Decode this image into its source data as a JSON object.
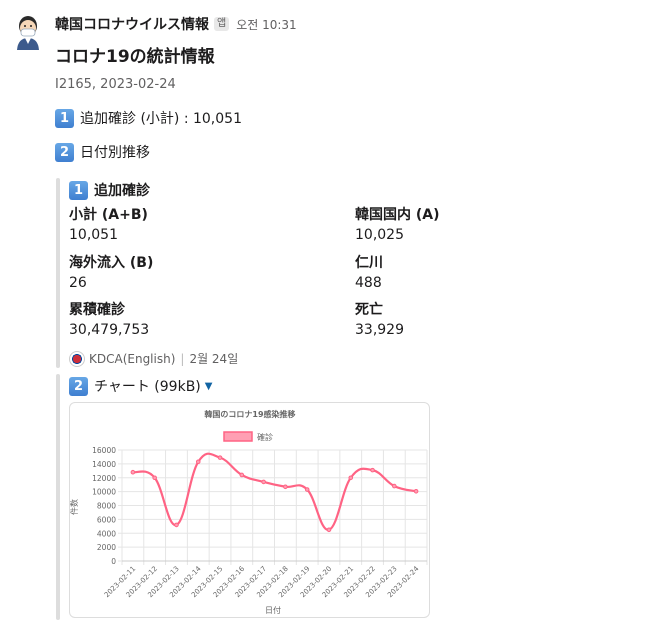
{
  "message": {
    "sender": "韓国コロナウイルス情報",
    "app_badge": "앱",
    "time": "오전 10:31",
    "title": "コロナ19の統計情報",
    "meta": "I2165, 2023-02-24",
    "lines": [
      {
        "num": "1",
        "text": "追加確診 (小計) : 10,051"
      },
      {
        "num": "2",
        "text": "日付別推移"
      }
    ]
  },
  "attachment": {
    "num": "1",
    "title": "追加確診",
    "fields": [
      {
        "label": "小計 (A+B)",
        "value": "10,051"
      },
      {
        "label": "韓国国内 (A)",
        "value": "10,025"
      },
      {
        "label": "海外流入 (B)",
        "value": "26"
      },
      {
        "label": "仁川",
        "value": "488"
      },
      {
        "label": "累積確診",
        "value": "30,479,753"
      },
      {
        "label": "死亡",
        "value": "33,929"
      }
    ],
    "footer_source": "KDCA(English)",
    "footer_date": "2월 24일"
  },
  "chart_attachment": {
    "num": "2",
    "title": "チャート (99kB)"
  },
  "chart_data": {
    "type": "line",
    "title": "韓国のコロナ19感染推移",
    "xlabel": "日付",
    "ylabel": "件数",
    "legend": "top-center",
    "ylim": [
      0,
      16000
    ],
    "y_ticks": [
      0,
      2000,
      4000,
      6000,
      8000,
      10000,
      12000,
      14000,
      16000
    ],
    "categories": [
      "2023-02-11",
      "2023-02-12",
      "2023-02-13",
      "2023-02-14",
      "2023-02-15",
      "2023-02-16",
      "2023-02-17",
      "2023-02-18",
      "2023-02-19",
      "2023-02-20",
      "2023-02-21",
      "2023-02-22",
      "2023-02-23",
      "2023-02-24"
    ],
    "series": [
      {
        "name": "確診",
        "color": "#ff6384",
        "fill": "#ff9fb3",
        "values": [
          12800,
          12000,
          5200,
          14300,
          14900,
          12400,
          11400,
          10700,
          10300,
          4500,
          12000,
          13100,
          10800,
          10051
        ]
      }
    ]
  }
}
